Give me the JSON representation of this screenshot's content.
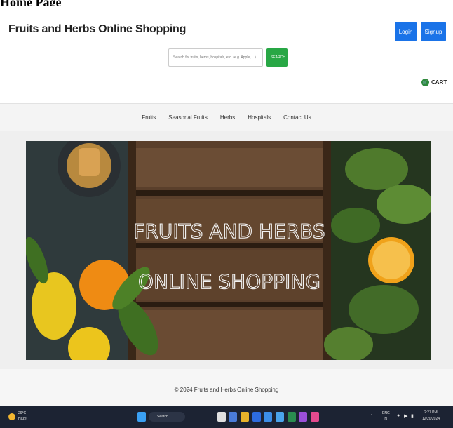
{
  "caption": "Home Page",
  "header": {
    "title": "Fruits and Herbs Online Shopping",
    "login_label": "Login",
    "signup_label": "Signup"
  },
  "search": {
    "placeholder": "Search for fruits, herbs, hospitals, etc. (e.g. Apple, ...)",
    "button_label": "SEARCH"
  },
  "cart": {
    "label": "CART",
    "icon": "cart-icon"
  },
  "nav": {
    "items": [
      "Fruits",
      "Seasonal Fruits",
      "Herbs",
      "Hospitals",
      "Contact Us"
    ]
  },
  "banner": {
    "line1": "FRUITS AND HERBS",
    "line2": "ONLINE SHOPPING"
  },
  "footer": {
    "text": "© 2024 Fruits and Herbs Online Shopping"
  },
  "taskbar": {
    "weather_temp": "29°C",
    "weather_desc": "Haze",
    "search_label": "Search",
    "clock_time": "2:27 PM",
    "clock_date": "12/20/2024",
    "lang": "ENG",
    "lang_sub": "IN"
  },
  "colors": {
    "primary_blue": "#1a73e8",
    "search_green": "#28a745",
    "taskbar": "#1c2333"
  }
}
